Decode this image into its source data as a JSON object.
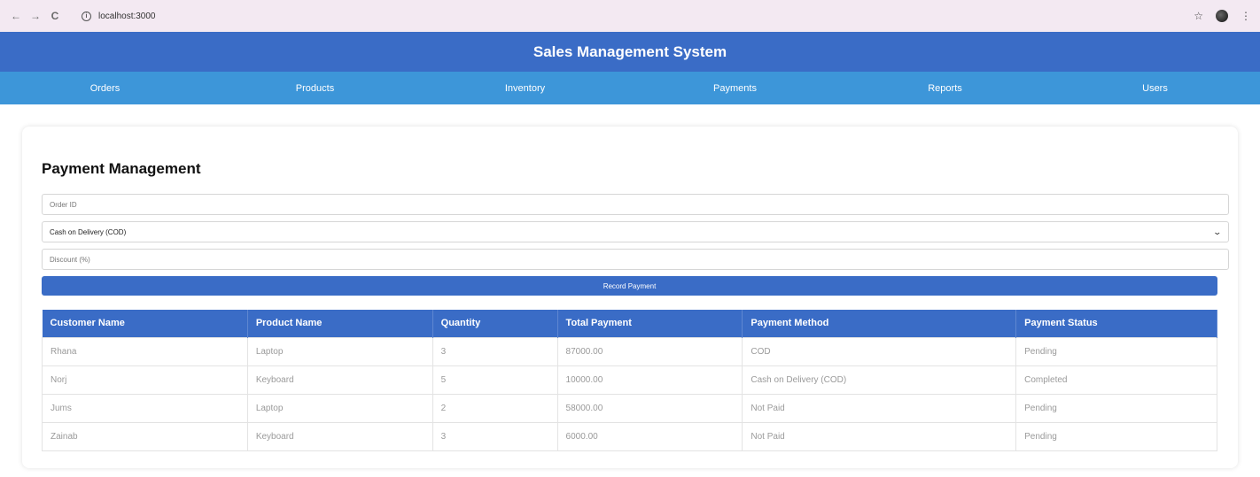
{
  "browser": {
    "url": "localhost:3000",
    "back_icon": "←",
    "forward_icon": "→",
    "reload_icon": "C",
    "info_icon": "i",
    "star_icon": "☆",
    "menu_icon": "⋮"
  },
  "app": {
    "title": "Sales Management System",
    "nav": [
      "Orders",
      "Products",
      "Inventory",
      "Payments",
      "Reports",
      "Users"
    ]
  },
  "page": {
    "title": "Payment Management",
    "order_id_placeholder": "Order ID",
    "payment_method_selected": "Cash on Delivery (COD)",
    "discount_placeholder": "Discount (%)",
    "record_button": "Record Payment"
  },
  "table": {
    "headers": [
      "Customer Name",
      "Product Name",
      "Quantity",
      "Total Payment",
      "Payment Method",
      "Payment Status"
    ],
    "rows": [
      [
        "Rhana",
        "Laptop",
        "3",
        "87000.00",
        "COD",
        "Pending"
      ],
      [
        "Norj",
        "Keyboard",
        "5",
        "10000.00",
        "Cash on Delivery (COD)",
        "Completed"
      ],
      [
        "Jums",
        "Laptop",
        "2",
        "58000.00",
        "Not Paid",
        "Pending"
      ],
      [
        "Zainab",
        "Keyboard",
        "3",
        "6000.00",
        "Not Paid",
        "Pending"
      ]
    ]
  },
  "colors": {
    "header_blue": "#3a6cc6",
    "nav_blue": "#3d96d9",
    "browser_bar": "#f3e9f2"
  }
}
